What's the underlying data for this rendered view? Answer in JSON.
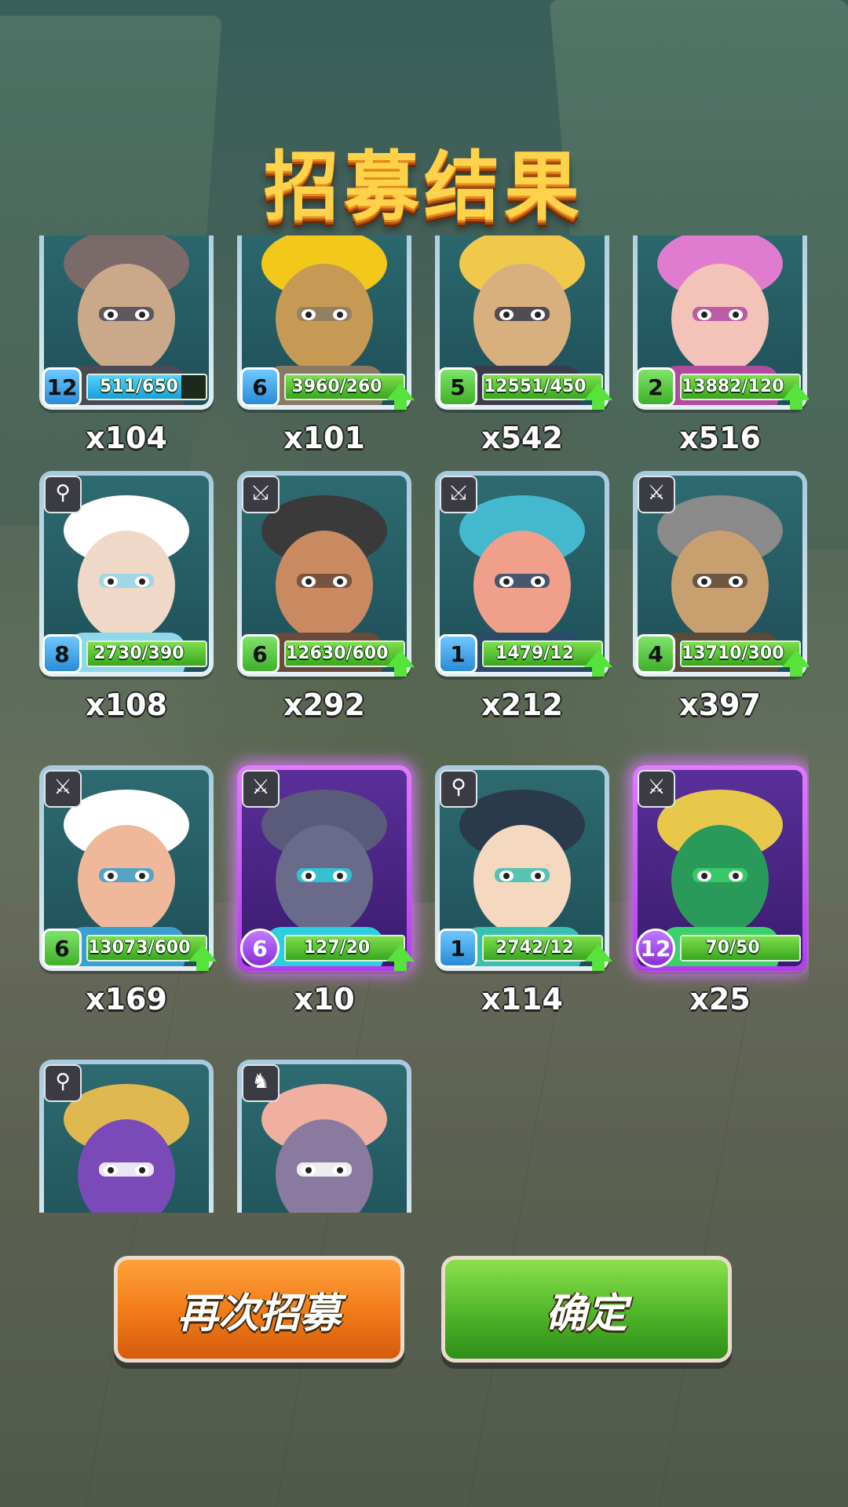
{
  "title": "招募结果",
  "buttons": {
    "recruit_again": "再次招募",
    "confirm": "确定"
  },
  "colors": {
    "title": "#ffd24a",
    "recruit_button": "#f07a17",
    "confirm_button": "#4fb52a"
  },
  "heroes": [
    {
      "name": "hero-1",
      "class_icon": "",
      "level": "12",
      "level_style": "blue",
      "progress": "511/650",
      "progress_fraction": 0.79,
      "bar_style": "blue",
      "upgrade": false,
      "count": "x104"
    },
    {
      "name": "hero-2",
      "class_icon": "",
      "level": "6",
      "level_style": "blue",
      "progress": "3960/260",
      "progress_fraction": 1,
      "bar_style": "green",
      "upgrade": true,
      "count": "x101"
    },
    {
      "name": "hero-3",
      "class_icon": "",
      "level": "5",
      "level_style": "green",
      "progress": "12551/450",
      "progress_fraction": 1,
      "bar_style": "green",
      "upgrade": true,
      "count": "x542"
    },
    {
      "name": "hero-4",
      "class_icon": "",
      "level": "2",
      "level_style": "green",
      "progress": "13882/120",
      "progress_fraction": 1,
      "bar_style": "green",
      "upgrade": true,
      "count": "x516"
    },
    {
      "name": "hero-5",
      "class_icon": "staff",
      "level": "8",
      "level_style": "blue",
      "progress": "2730/390",
      "progress_fraction": 1,
      "bar_style": "green",
      "upgrade": false,
      "count": "x108"
    },
    {
      "name": "hero-6",
      "class_icon": "crossbow",
      "level": "6",
      "level_style": "green",
      "progress": "12630/600",
      "progress_fraction": 1,
      "bar_style": "green",
      "upgrade": true,
      "count": "x292"
    },
    {
      "name": "hero-7",
      "class_icon": "crossbow",
      "level": "1",
      "level_style": "blue",
      "progress": "1479/12",
      "progress_fraction": 1,
      "bar_style": "green",
      "upgrade": true,
      "count": "x212"
    },
    {
      "name": "hero-8",
      "class_icon": "sword",
      "level": "4",
      "level_style": "green",
      "progress": "13710/300",
      "progress_fraction": 1,
      "bar_style": "green",
      "upgrade": true,
      "count": "x397"
    },
    {
      "name": "hero-9",
      "class_icon": "sword",
      "level": "6",
      "level_style": "green",
      "progress": "13073/600",
      "progress_fraction": 1,
      "bar_style": "green",
      "upgrade": true,
      "count": "x169"
    },
    {
      "name": "hero-10",
      "class_icon": "sword",
      "level": "6",
      "level_style": "purple",
      "progress": "127/20",
      "progress_fraction": 1,
      "bar_style": "green",
      "upgrade": true,
      "count": "x10",
      "rarity": "purple"
    },
    {
      "name": "hero-11",
      "class_icon": "staff",
      "level": "1",
      "level_style": "blue",
      "progress": "2742/12",
      "progress_fraction": 1,
      "bar_style": "green",
      "upgrade": true,
      "count": "x114"
    },
    {
      "name": "hero-12",
      "class_icon": "sword",
      "level": "12",
      "level_style": "purple",
      "progress": "70/50",
      "progress_fraction": 1,
      "bar_style": "green",
      "upgrade": false,
      "count": "x25",
      "rarity": "purple"
    },
    {
      "name": "hero-13",
      "class_icon": "staff",
      "level": "",
      "level_style": "",
      "progress": "",
      "progress_fraction": 0,
      "bar_style": "",
      "upgrade": false,
      "count": ""
    },
    {
      "name": "hero-14",
      "class_icon": "horse",
      "level": "",
      "level_style": "",
      "progress": "",
      "progress_fraction": 0,
      "bar_style": "",
      "upgrade": false,
      "count": ""
    }
  ]
}
